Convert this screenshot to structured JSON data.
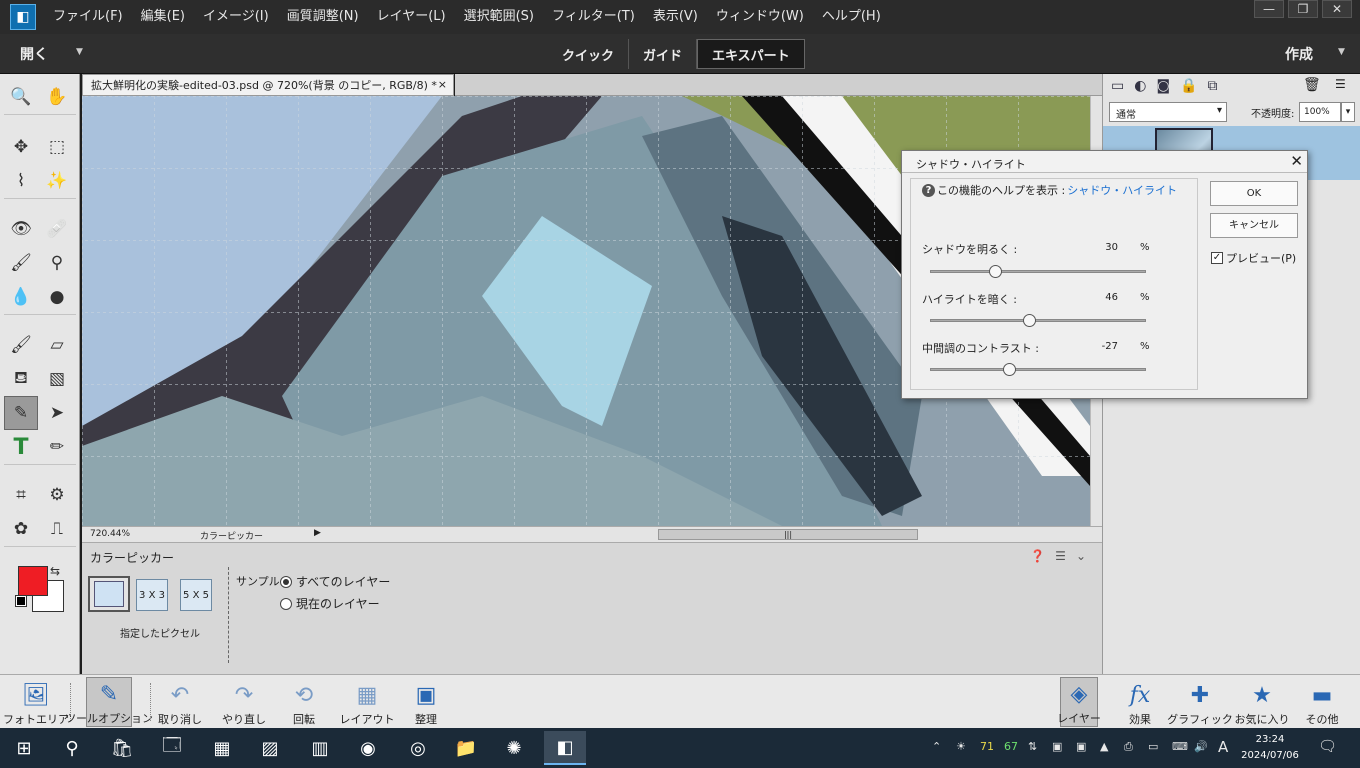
{
  "menu": {
    "items": [
      "ファイル(F)",
      "編集(E)",
      "イメージ(I)",
      "画質調整(N)",
      "レイヤー(L)",
      "選択範囲(S)",
      "フィルター(T)",
      "表示(V)",
      "ウィンドウ(W)",
      "ヘルプ(H)"
    ]
  },
  "window_controls": {
    "minimize": "—",
    "restore": "❐",
    "close": "✕"
  },
  "modebar": {
    "open": "開く",
    "tabs": [
      "クイック",
      "ガイド",
      "エキスパート"
    ],
    "active_tab": "エキスパート",
    "create": "作成"
  },
  "document": {
    "tab_title": "拡大鮮明化の実験-edited-03.psd @ 720%(背景 のコピー, RGB/8) *",
    "close": "×",
    "zoom": "720.44%",
    "status_info": "カラーピッカー",
    "scroll_grip": "|||"
  },
  "tool_options": {
    "title": "カラーピッカー",
    "samples": [
      "3 X 3",
      "5 X 5"
    ],
    "sample_caption": "指定したピクセル",
    "sample_label": "サンプル：",
    "radio_all": "すべてのレイヤー",
    "radio_current": "現在のレイヤー"
  },
  "layers_panel": {
    "blend_mode": "通常",
    "opacity_label": "不透明度:",
    "opacity_value": "100%"
  },
  "dialog": {
    "title": "シャドウ・ハイライト",
    "help_text": "この機能のヘルプを表示 : ",
    "help_link": "シャドウ・ハイライト",
    "ok": "OK",
    "cancel": "キャンセル",
    "preview": "プレビュー(P)",
    "preview_checked": true,
    "sliders": [
      {
        "label": "シャドウを明るく :",
        "value": "30",
        "unit": "%",
        "fraction": 0.3
      },
      {
        "label": "ハイライトを暗く :",
        "value": "46",
        "unit": "%",
        "fraction": 0.46
      },
      {
        "label": "中間調のコントラスト :",
        "value": "-27",
        "unit": "%",
        "fraction": 0.365
      }
    ]
  },
  "bottom_left": [
    {
      "label": "フォトエリア",
      "icon": "photo-bin-icon"
    },
    {
      "label": "ツールオプション",
      "icon": "tool-options-icon"
    },
    {
      "label": "取り消し",
      "icon": "undo-icon"
    },
    {
      "label": "やり直し",
      "icon": "redo-icon"
    },
    {
      "label": "回転",
      "icon": "rotate-icon"
    },
    {
      "label": "レイアウト",
      "icon": "layout-icon"
    },
    {
      "label": "整理",
      "icon": "organizer-icon"
    }
  ],
  "bottom_right": [
    {
      "label": "レイヤー",
      "icon": "layers-icon"
    },
    {
      "label": "効果",
      "icon": "fx-icon"
    },
    {
      "label": "グラフィック",
      "icon": "plus-icon"
    },
    {
      "label": "お気に入り",
      "icon": "star-icon"
    },
    {
      "label": "その他",
      "icon": "more-icon"
    }
  ],
  "taskbar": {
    "tray_temp1": "71",
    "tray_temp2": "67",
    "ime": "A",
    "time": "23:24",
    "date": "2024/07/06"
  },
  "colors": {
    "foreground": "#ef1d24",
    "background": "#ffffff",
    "accent": "#1a6fd1"
  }
}
